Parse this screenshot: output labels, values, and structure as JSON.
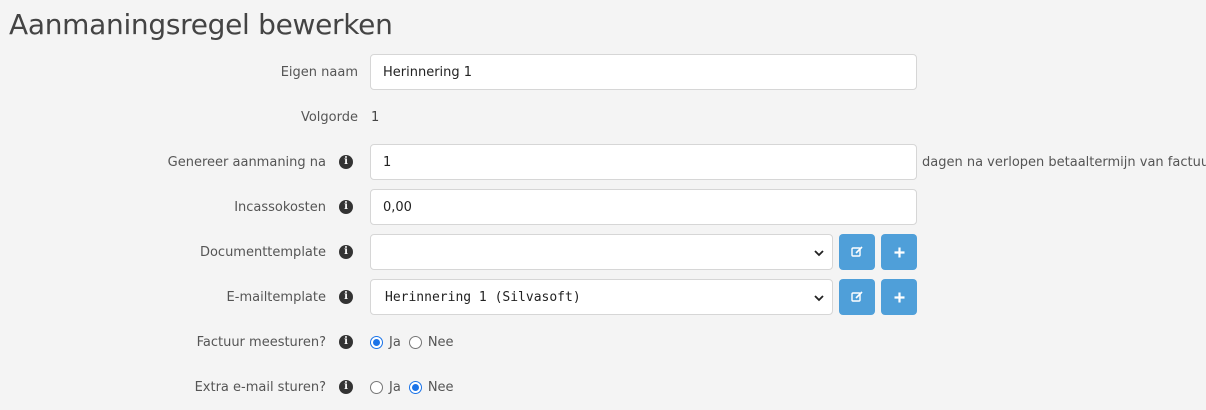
{
  "page": {
    "title": "Aanmaningsregel bewerken"
  },
  "fields": {
    "eigen_naam": {
      "label": "Eigen naam",
      "value": "Herinnering 1"
    },
    "volgorde": {
      "label": "Volgorde",
      "value": "1"
    },
    "genereer": {
      "label": "Genereer aanmaning na",
      "value": "1",
      "suffix": "dagen na verlopen betaaltermijn van factuur"
    },
    "incassokosten": {
      "label": "Incassokosten",
      "value": "0,00"
    },
    "documenttemplate": {
      "label": "Documenttemplate",
      "selected": ""
    },
    "emailtemplate": {
      "label": "E-mailtemplate",
      "selected": "Herinnering 1 (Silvasoft)"
    },
    "factuur_meesturen": {
      "label": "Factuur meesturen?",
      "options": [
        "Ja",
        "Nee"
      ],
      "selected": "Ja"
    },
    "extra_email": {
      "label": "Extra e-mail sturen?",
      "options": [
        "Ja",
        "Nee"
      ],
      "selected": "Nee"
    }
  },
  "icons": {
    "info": "info-circle-icon",
    "edit": "edit-icon",
    "add": "plus-icon",
    "dropdown": "chevron-down-icon"
  },
  "colors": {
    "accent": "#4f9fd9",
    "radio_checked": "#1a73e8",
    "background": "#f4f4f4"
  }
}
